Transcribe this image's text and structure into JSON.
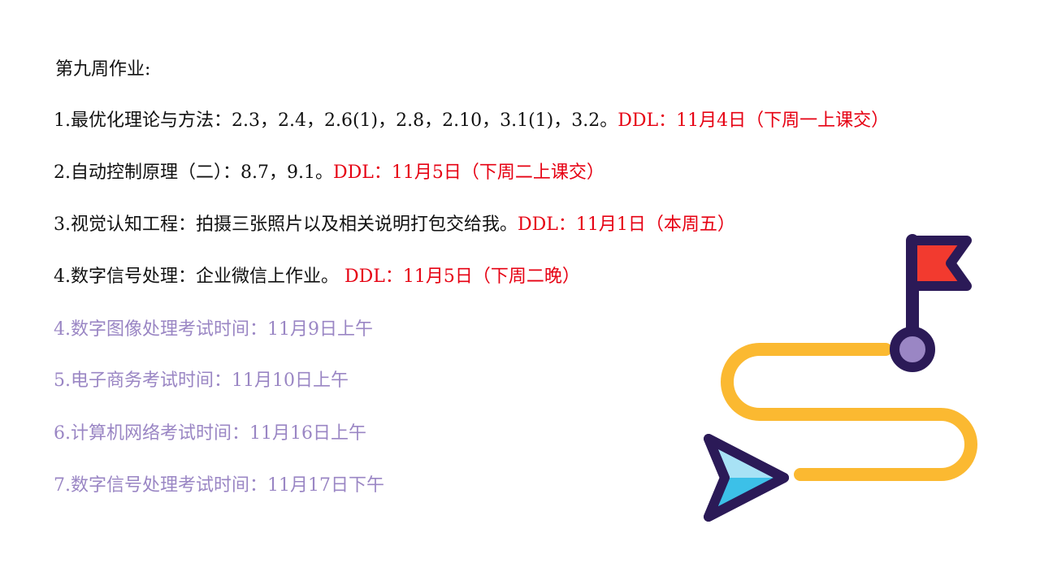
{
  "slide": {
    "title": "第九周作业:",
    "items": [
      {
        "text": "1.最优化理论与方法：2.3，2.4，2.6(1)，2.8，2.10，3.1(1)，3.2。",
        "deadline": "DDL：11月4日（下周一上课交）"
      },
      {
        "text": "2.自动控制原理（二）：8.7，9.1。",
        "deadline": "DDL：11月5日（下周二上课交）"
      },
      {
        "text": "3.视觉认知工程：拍摄三张照片以及相关说明打包交给我。",
        "deadline": "DDL：11月1日（本周五）"
      },
      {
        "text": "4.数字信号处理：企业微信上作业。 ",
        "deadline": "DDL：11月5日（下周二晚）"
      }
    ],
    "exams": [
      "4.数字图像处理考试时间：11月9日上午",
      "5.电子商务考试时间：11月10日上午",
      "6.计算机网络考试时间：11月16日上午",
      "7.数字信号处理考试时间：11月17日下午"
    ]
  },
  "colors": {
    "text": "#111111",
    "deadline": "#e60012",
    "exam": "#9a86c4",
    "road": "#fbb931",
    "outline": "#2b1a57",
    "flag": "#f23a2f",
    "pin": "#9a86c4",
    "arrow_light": "#a8e2f5",
    "arrow_dark": "#3cc0e8"
  },
  "icons": [
    "flag-icon",
    "winding-road-icon",
    "cursor-arrow-icon"
  ]
}
